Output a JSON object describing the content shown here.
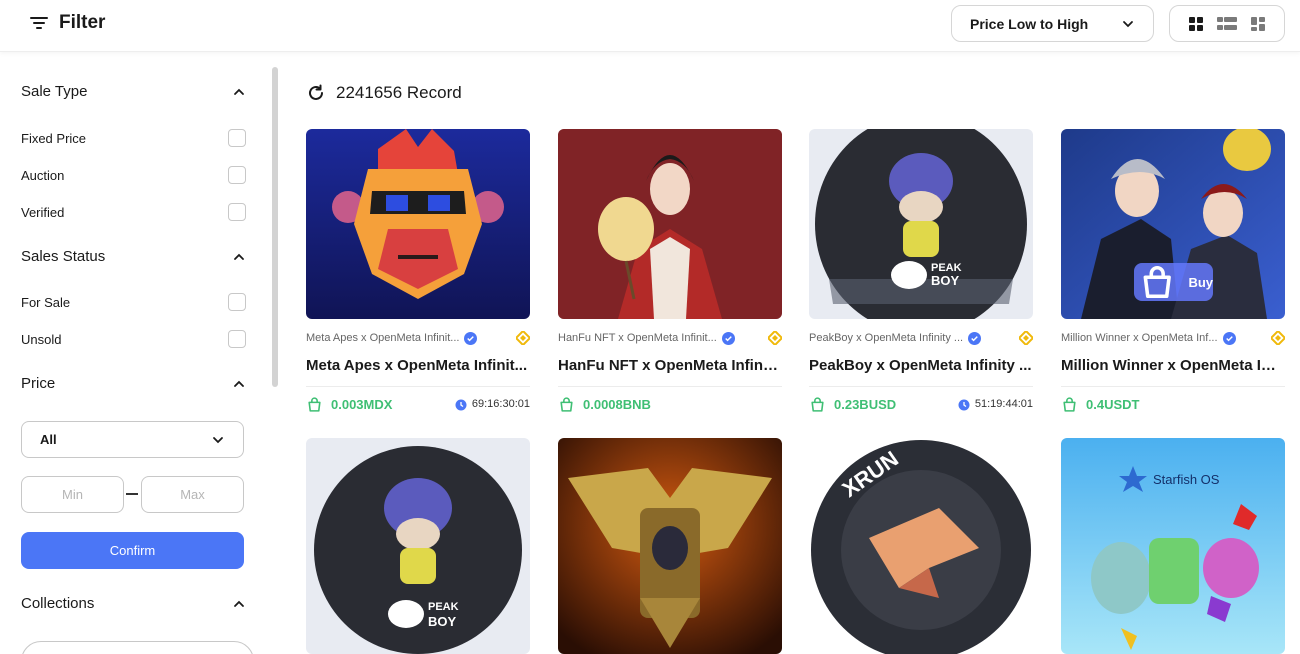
{
  "header": {
    "filter_label": "Filter",
    "sort_value": "Price Low to High"
  },
  "sidebar": {
    "sale_type": {
      "title": "Sale Type",
      "options": [
        "Fixed Price",
        "Auction",
        "Verified"
      ]
    },
    "sales_status": {
      "title": "Sales Status",
      "options": [
        "For Sale",
        "Unsold"
      ]
    },
    "price": {
      "title": "Price",
      "currency_selected": "All",
      "min_placeholder": "Min",
      "max_placeholder": "Max",
      "confirm_label": "Confirm"
    },
    "collections": {
      "title": "Collections"
    }
  },
  "main": {
    "record_count": "2241656 Record",
    "items": [
      {
        "collection": "Meta Apes x OpenMeta Infinit...",
        "name": "Meta Apes x OpenMeta Infinit...",
        "price": "0.003MDX",
        "timer": "69:16:30:01"
      },
      {
        "collection": "HanFu NFT x OpenMeta Infinit...",
        "name": "HanFu NFT x OpenMeta Infinit...",
        "price": "0.0008BNB",
        "timer": ""
      },
      {
        "collection": "PeakBoy x OpenMeta Infinity ...",
        "name": "PeakBoy x OpenMeta Infinity ...",
        "price": "0.23BUSD",
        "timer": "51:19:44:01"
      },
      {
        "collection": "Million Winner x OpenMeta Inf...",
        "name": "Million Winner x OpenMeta Inf...",
        "price": "0.4USDT",
        "timer": "",
        "buy_label": "Buy"
      }
    ],
    "row2": [
      {
        "art_text": "PEAK BOY"
      },
      {
        "art_text": ""
      },
      {
        "art_text": "XRUN"
      },
      {
        "art_text": "Starfish OS"
      }
    ]
  },
  "colors": {
    "accent": "#4b76f6",
    "price_green": "#3fbf74",
    "verified_blue": "#4b76f6",
    "bsc_gold": "#f0b90b"
  }
}
